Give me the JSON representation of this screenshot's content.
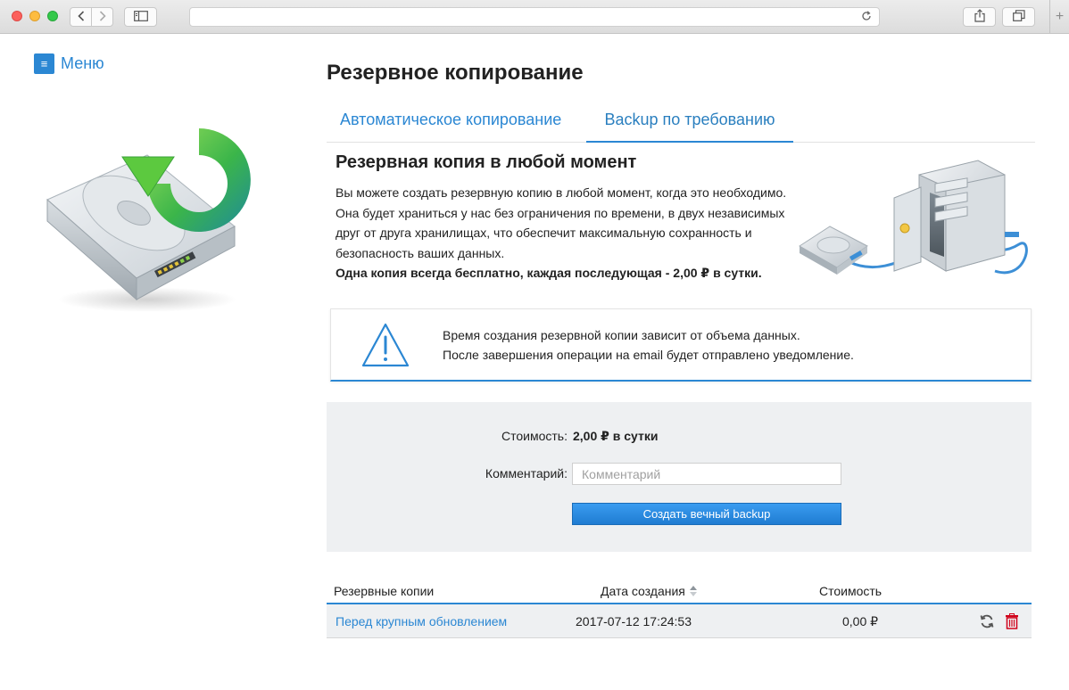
{
  "sidebar": {
    "menu_label": "Меню"
  },
  "page": {
    "title": "Резервное копирование"
  },
  "tabs": [
    {
      "label": "Автоматическое копирование",
      "active": false
    },
    {
      "label": "Backup по требованию",
      "active": true
    }
  ],
  "promo": {
    "title": "Резервная копия в любой момент",
    "text": "Вы можете создать резервную копию в любой момент, когда это необходимо. Она будет храниться у нас без ограничения по времени, в двух независимых друг от друга хранилищах, что обеспечит максимальную сохранность и безопасность ваших данных.",
    "bold_text": "Одна копия всегда бесплатно, каждая последующая - 2,00 ₽ в сутки."
  },
  "notice": {
    "line1": "Время создания резервной копии зависит от объема данных.",
    "line2": "После завершения операции на email будет отправлено уведомление."
  },
  "form": {
    "cost_label": "Стоимость:",
    "cost_value": "2,00 ₽ в сутки",
    "comment_label": "Комментарий:",
    "comment_placeholder": "Комментарий",
    "comment_value": "",
    "submit_label": "Создать вечный backup"
  },
  "table": {
    "headers": {
      "name": "Резервные копии",
      "date": "Дата создания",
      "cost": "Стоимость"
    },
    "sort": {
      "column": "date"
    },
    "rows": [
      {
        "name": "Перед крупным обновлением",
        "date": "2017-07-12 17:24:53",
        "cost": "0,00 ₽"
      }
    ]
  },
  "colors": {
    "accent": "#2b87d3",
    "panel": "#eef0f2",
    "delete": "#d0021b"
  },
  "icons": [
    "back-icon",
    "forward-icon",
    "sidebar-toggle-icon",
    "reload-icon",
    "share-icon",
    "tabs-icon",
    "new-tab-icon",
    "menu-icon",
    "warning-icon",
    "sort-icon",
    "restore-icon",
    "trash-icon"
  ]
}
